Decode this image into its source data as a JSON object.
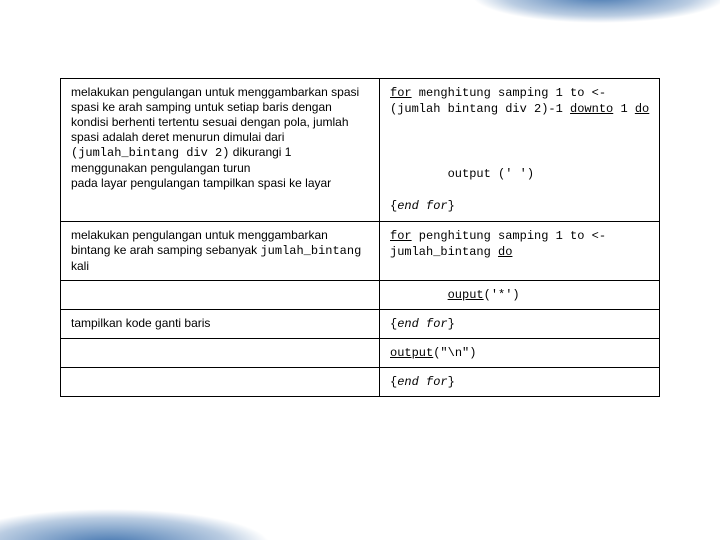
{
  "rows": [
    {
      "left": {
        "text_pre": "melakukan pengulangan untuk menggambarkan spasi spasi ke arah samping untuk setiap baris dengan kondisi berhenti tertentu sesuai dengan pola, jumlah spasi adalah deret menurun dimulai dari ",
        "mono": "(jumlah_bintang div 2)",
        "text_post": " dikurangi 1 menggunakan pengulangan turun\npada layar pengulangan tampilkan spasi ke layar"
      },
      "right": {
        "segments": [
          {
            "kw": true,
            "t": "for"
          },
          {
            "t": " menghitung samping 1 to <- (jumlah bintang div 2)-1 "
          },
          {
            "kw": true,
            "t": "downto"
          },
          {
            "t": " 1 "
          },
          {
            "kw": true,
            "t": "do"
          },
          {
            "t": "\n\n\n\n        output (' ')\n\n{"
          },
          {
            "i": true,
            "t": "end for"
          },
          {
            "t": "}"
          }
        ]
      }
    },
    {
      "left": {
        "text_pre": "melakukan pengulangan untuk menggambarkan bintang ke arah samping sebanyak ",
        "mono": "jumlah_bintang",
        "text_post": " kali"
      },
      "right": {
        "segments": [
          {
            "kw": true,
            "t": "for"
          },
          {
            "t": " penghitung samping 1 to <- jumlah_bintang "
          },
          {
            "kw": true,
            "t": "do"
          }
        ]
      }
    },
    {
      "left": null,
      "right": {
        "segments": [
          {
            "indent": true,
            "kw": true,
            "t": "ouput"
          },
          {
            "t": "('*')"
          }
        ]
      }
    },
    {
      "left": {
        "text_pre": "tampilkan kode ganti baris",
        "mono": "",
        "text_post": ""
      },
      "right": {
        "segments": [
          {
            "t": "{"
          },
          {
            "i": true,
            "t": "end for"
          },
          {
            "t": "}"
          }
        ]
      }
    },
    {
      "left": null,
      "right": {
        "segments": [
          {
            "kw": true,
            "t": "output"
          },
          {
            "t": "(\"\\n\")"
          }
        ]
      }
    },
    {
      "left": null,
      "right": {
        "segments": [
          {
            "t": "{"
          },
          {
            "i": true,
            "t": "end for"
          },
          {
            "t": "}"
          }
        ]
      }
    }
  ]
}
